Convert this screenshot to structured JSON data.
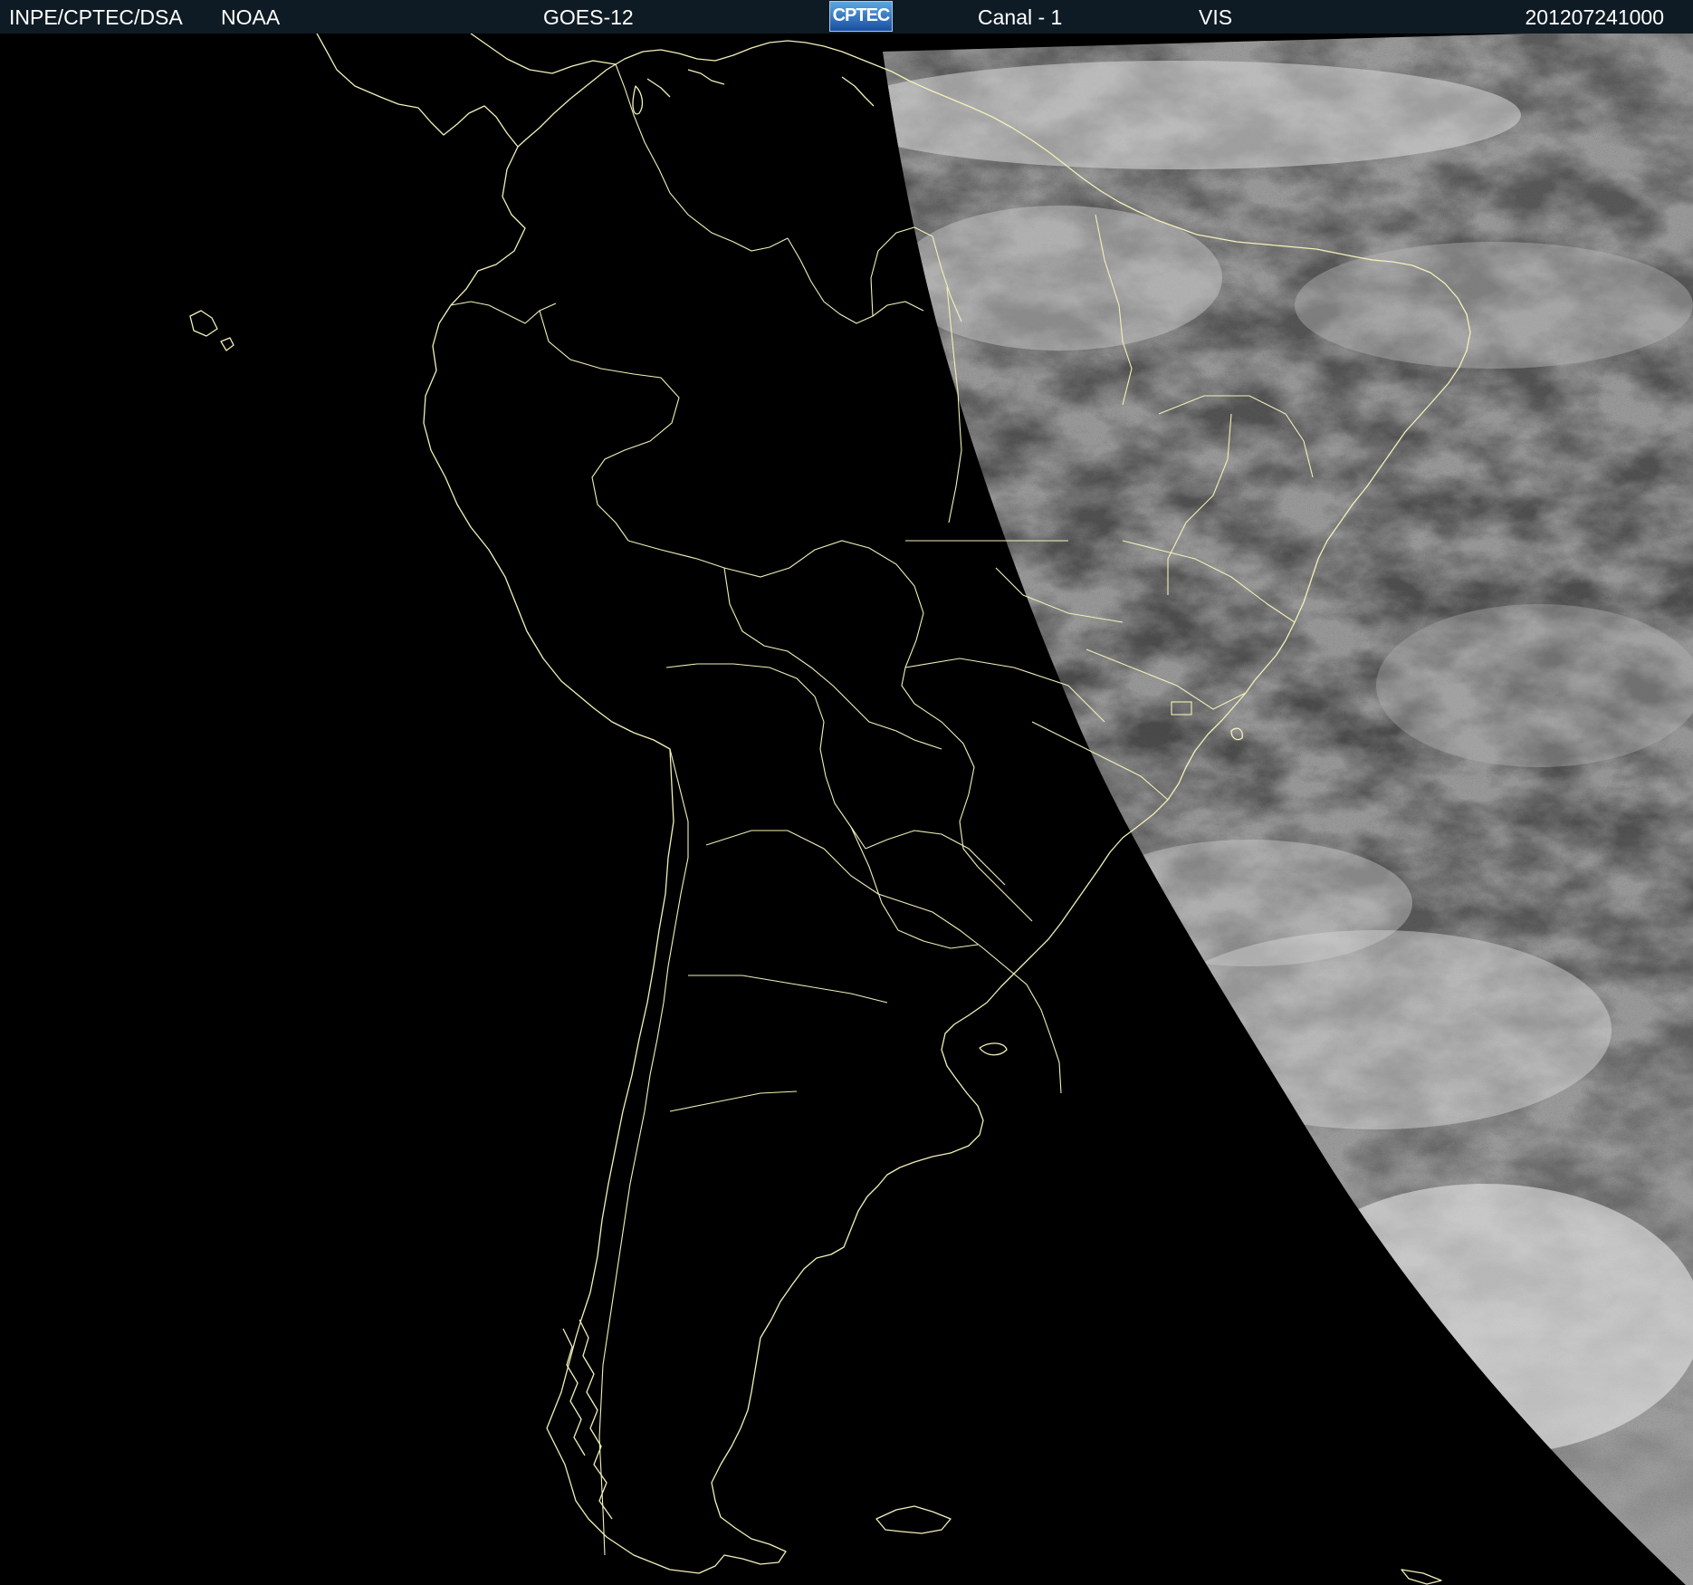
{
  "header": {
    "org": "INPE/CPTEC/DSA",
    "agency": "NOAA",
    "satellite": "GOES-12",
    "logo_text": "CPTEC",
    "channel": "Canal - 1",
    "band": "VIS",
    "timestamp": "201207241000"
  },
  "map": {
    "region": "South America",
    "product": "visible satellite imagery",
    "illuminated_side": "east",
    "colors": {
      "night": "#000000",
      "boundaries": "#f3f1b9",
      "header_background": "#0f1b24",
      "header_text": "#ffffff"
    }
  }
}
